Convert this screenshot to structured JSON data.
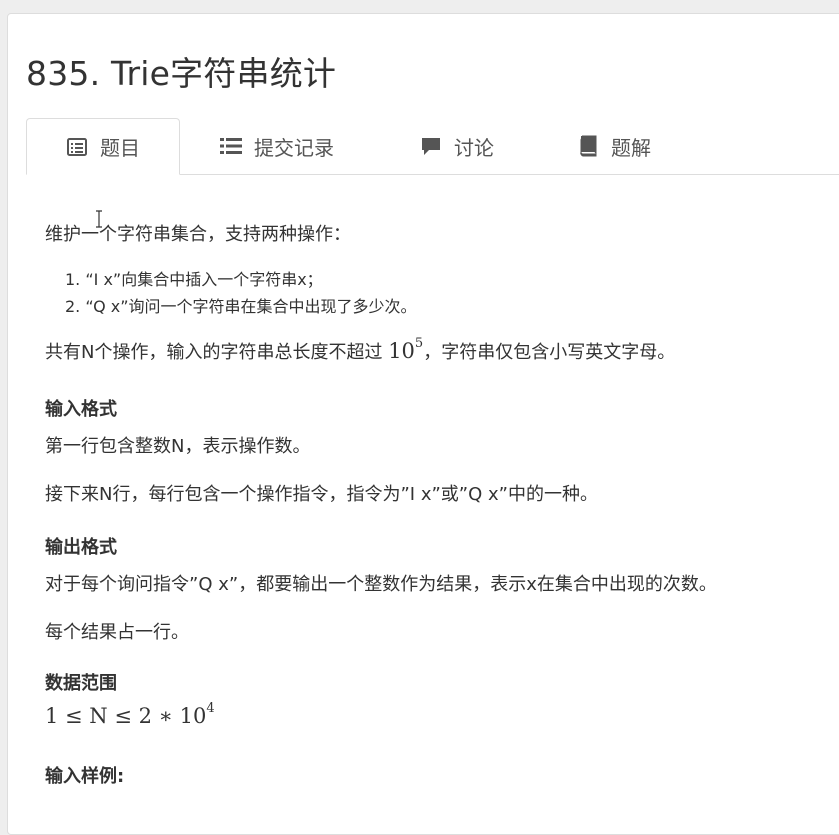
{
  "problem": {
    "title": "835. Trie字符串统计"
  },
  "tabs": [
    {
      "label": "题目",
      "icon": "list-alt-icon"
    },
    {
      "label": "提交记录",
      "icon": "list-icon"
    },
    {
      "label": "讨论",
      "icon": "comment-icon"
    },
    {
      "label": "题解",
      "icon": "book-icon"
    }
  ],
  "description": {
    "intro": "维护一个字符串集合，支持两种操作：",
    "ops": [
      "1. “I x”向集合中插入一个字符串x；",
      "2. “Q x”询问一个字符串在集合中出现了多少次。"
    ],
    "constraint_prefix": "共有N个操作，输入的字符串总长度不超过 ",
    "constraint_base": "10",
    "constraint_exp": "5",
    "constraint_suffix": "，字符串仅包含小写英文字母。"
  },
  "input_format": {
    "heading": "输入格式",
    "line1": "第一行包含整数N，表示操作数。",
    "line2": "接下来N行，每行包含一个操作指令，指令为”I x”或”Q x”中的一种。"
  },
  "output_format": {
    "heading": "输出格式",
    "line1": "对于每个询问指令”Q x”，都要输出一个整数作为结果，表示x在集合中出现的次数。",
    "line2": "每个结果占一行。"
  },
  "data_range": {
    "heading": "数据范围",
    "formula_prefix": "1 ≤ N ≤ 2 ∗ 10",
    "formula_exp": "4"
  },
  "sample_input": {
    "heading": "输入样例:"
  }
}
